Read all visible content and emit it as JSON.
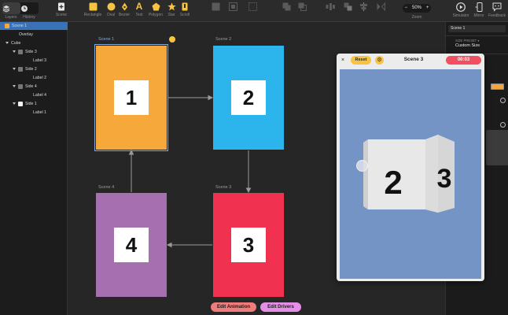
{
  "colors": {
    "accent_selection": "#3a72b8",
    "scene1": "#f7a83b",
    "scene2": "#2bb5ec",
    "scene3": "#f13150",
    "scene4": "#a66fb0",
    "preview_stage": "#7394c5",
    "reset_button": "#f6c343",
    "timer_badge": "#f0505f",
    "edit_animation": "#f07b7b",
    "edit_drivers": "#e58ee8"
  },
  "toolbar": {
    "layers": "Layers",
    "history": "History",
    "scene": "Scene",
    "rectangle": "Rectangle",
    "oval": "Oval",
    "bezier": "Bezier",
    "text": "Text",
    "polygon": "Polygon",
    "star": "Star",
    "scroll": "Scroll",
    "zoom": "Zoom",
    "zoom_value": "50%",
    "zoom_minus": "−",
    "zoom_plus": "+",
    "simulator": "Simulator",
    "mirror": "Mirror",
    "feedback": "Feedback"
  },
  "layers": [
    {
      "label": "Scene 1",
      "icon": "scene-icon"
    },
    {
      "label": "Overlay",
      "icon": "layer-icon"
    },
    {
      "label": "Cube",
      "icon": "group-icon"
    },
    {
      "label": "Side 3",
      "icon": "layer-icon"
    },
    {
      "label": "Label 3",
      "icon": "text-icon"
    },
    {
      "label": "Side 2",
      "icon": "layer-icon"
    },
    {
      "label": "Label 2",
      "icon": "text-icon"
    },
    {
      "label": "Side 4",
      "icon": "layer-icon"
    },
    {
      "label": "Label 4",
      "icon": "text-icon"
    },
    {
      "label": "Side 1",
      "icon": "layer-icon"
    },
    {
      "label": "Label 1",
      "icon": "text-icon"
    }
  ],
  "scenes": [
    {
      "label": "Scene 1",
      "number": "1"
    },
    {
      "label": "Scene 2",
      "number": "2"
    },
    {
      "label": "Scene 3",
      "number": "3"
    },
    {
      "label": "Scene 4",
      "number": "4"
    }
  ],
  "preview": {
    "close": "×",
    "reset": "Reset",
    "settings": "⚙",
    "title": "Scene 3",
    "timer": "00:03",
    "cube_front": "2",
    "cube_side": "3"
  },
  "inspector": {
    "scene_name": "Scene 1",
    "size_preset_label": "SIZE PRESET ▾",
    "size_preset_value": "Custom Size"
  },
  "bottom": {
    "edit_animation": "Edit Animation",
    "edit_drivers": "Edit Drivers"
  }
}
